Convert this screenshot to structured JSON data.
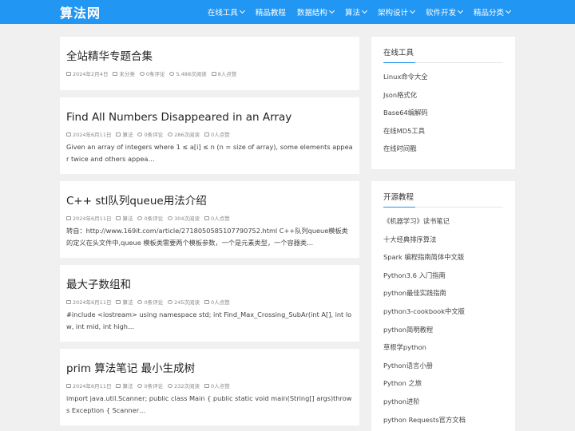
{
  "header": {
    "logo": "算法网",
    "nav": [
      {
        "label": "在线工具",
        "dropdown": true
      },
      {
        "label": "精品教程",
        "dropdown": false
      },
      {
        "label": "数据结构",
        "dropdown": true
      },
      {
        "label": "算法",
        "dropdown": true
      },
      {
        "label": "架构设计",
        "dropdown": true
      },
      {
        "label": "软件开发",
        "dropdown": true
      },
      {
        "label": "精品分类",
        "dropdown": true
      }
    ]
  },
  "posts": [
    {
      "title": "全站精华专题合集",
      "date": "2024年2月4日",
      "category": "未分类",
      "comments": "0条评论",
      "views": "5,488次阅读",
      "likes": "8人点赞",
      "excerpt": ""
    },
    {
      "title": "Find All Numbers Disappeared in an Array",
      "date": "2024年6月11日",
      "category": "算法",
      "comments": "0条评论",
      "views": "286次阅读",
      "likes": "0人点赞",
      "excerpt": "Given an array of integers where 1 ≤ a[i] ≤ n (n = size of array), some elements appear twice and others appea…"
    },
    {
      "title": "C++ stl队列queue用法介绍",
      "date": "2024年6月11日",
      "category": "算法",
      "comments": "0条评论",
      "views": "304次阅读",
      "likes": "0人点赞",
      "excerpt": "转自：http://www.169it.com/article/2718050585107790752.html C++队列queue模板类的定义在头文件中,queue 模板类需要两个模板参数，一个是元素类型，一个容器类…"
    },
    {
      "title": "最大子数组和",
      "date": "2024年6月11日",
      "category": "算法",
      "comments": "0条评论",
      "views": "245次阅读",
      "likes": "0人点赞",
      "excerpt": "#include <iostream> using namespace std; int Find_Max_Crossing_SubAr(int A[], int low, int mid, int high…"
    },
    {
      "title": "prim 算法笔记 最小生成树",
      "date": "2024年6月11日",
      "category": "算法",
      "comments": "0条评论",
      "views": "232次阅读",
      "likes": "0人点赞",
      "excerpt": "import java.util.Scanner; public class Main { public static void main(String[] args)throws Exception { Scanner…"
    }
  ],
  "sidebar": {
    "tools": {
      "title": "在线工具",
      "items": [
        "Linux命令大全",
        "Json格式化",
        "Base64编解码",
        "在线MD5工具",
        "在线时间戳"
      ]
    },
    "tutorials": {
      "title": "开源教程",
      "items": [
        "《机器学习》读书笔记",
        "十大经典排序算法",
        "Spark 编程指南简体中文版",
        "Python3.6 入门指南",
        "python最佳实践指南",
        "python3-cookbook中文版",
        "python简明教程",
        "草根学python",
        "Python语言小册",
        "Python 之旅",
        "python进阶",
        "python Requests官方文档"
      ]
    }
  },
  "colors": {
    "header_bg": "#2196f3",
    "page_bg": "#f0f0f0"
  }
}
